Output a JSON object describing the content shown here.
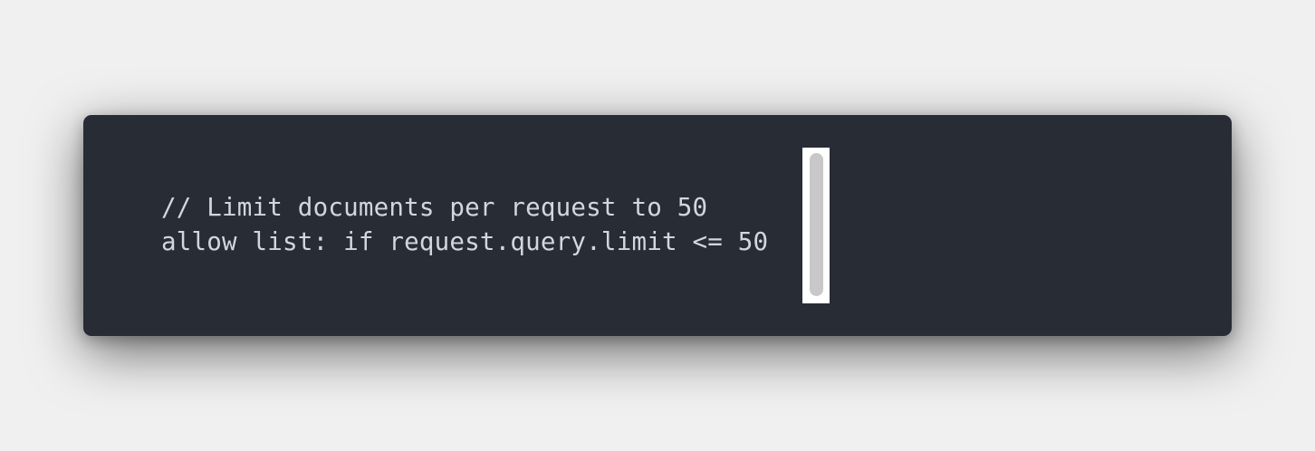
{
  "code": {
    "lines": [
      "// Limit documents per request to 50",
      "allow list: if request.query.limit <= 50"
    ]
  },
  "colors": {
    "page_background": "#f0f0f0",
    "editor_background": "#282c35",
    "code_text": "#d3d6de",
    "scrollbar_track": "#ffffff",
    "scrollbar_thumb": "#c8c8c8"
  }
}
